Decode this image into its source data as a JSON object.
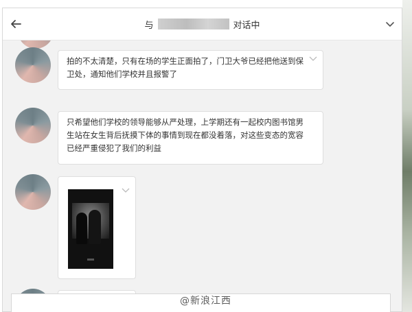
{
  "window": {
    "title_prefix": "与",
    "title_suffix": "对话中",
    "back_icon": "arrow-left-icon",
    "menu_icon": "chevron-down-icon"
  },
  "messages": [
    {
      "type": "text",
      "text": "拍的不太清楚，只有在场的学生正面拍了，门卫大爷已经把他送到保卫处，通知他们学校并且报警了"
    },
    {
      "type": "text",
      "text": "只希望他们学校的领导能够从严处理，上学期还有一起校内图书馆男生站在女生背后抚摸下体的事情到现在都没着落，对这些变态的宽容已经严重侵犯了我们的利益"
    },
    {
      "type": "image"
    },
    {
      "type": "image"
    }
  ],
  "watermark": "@新浪江西"
}
